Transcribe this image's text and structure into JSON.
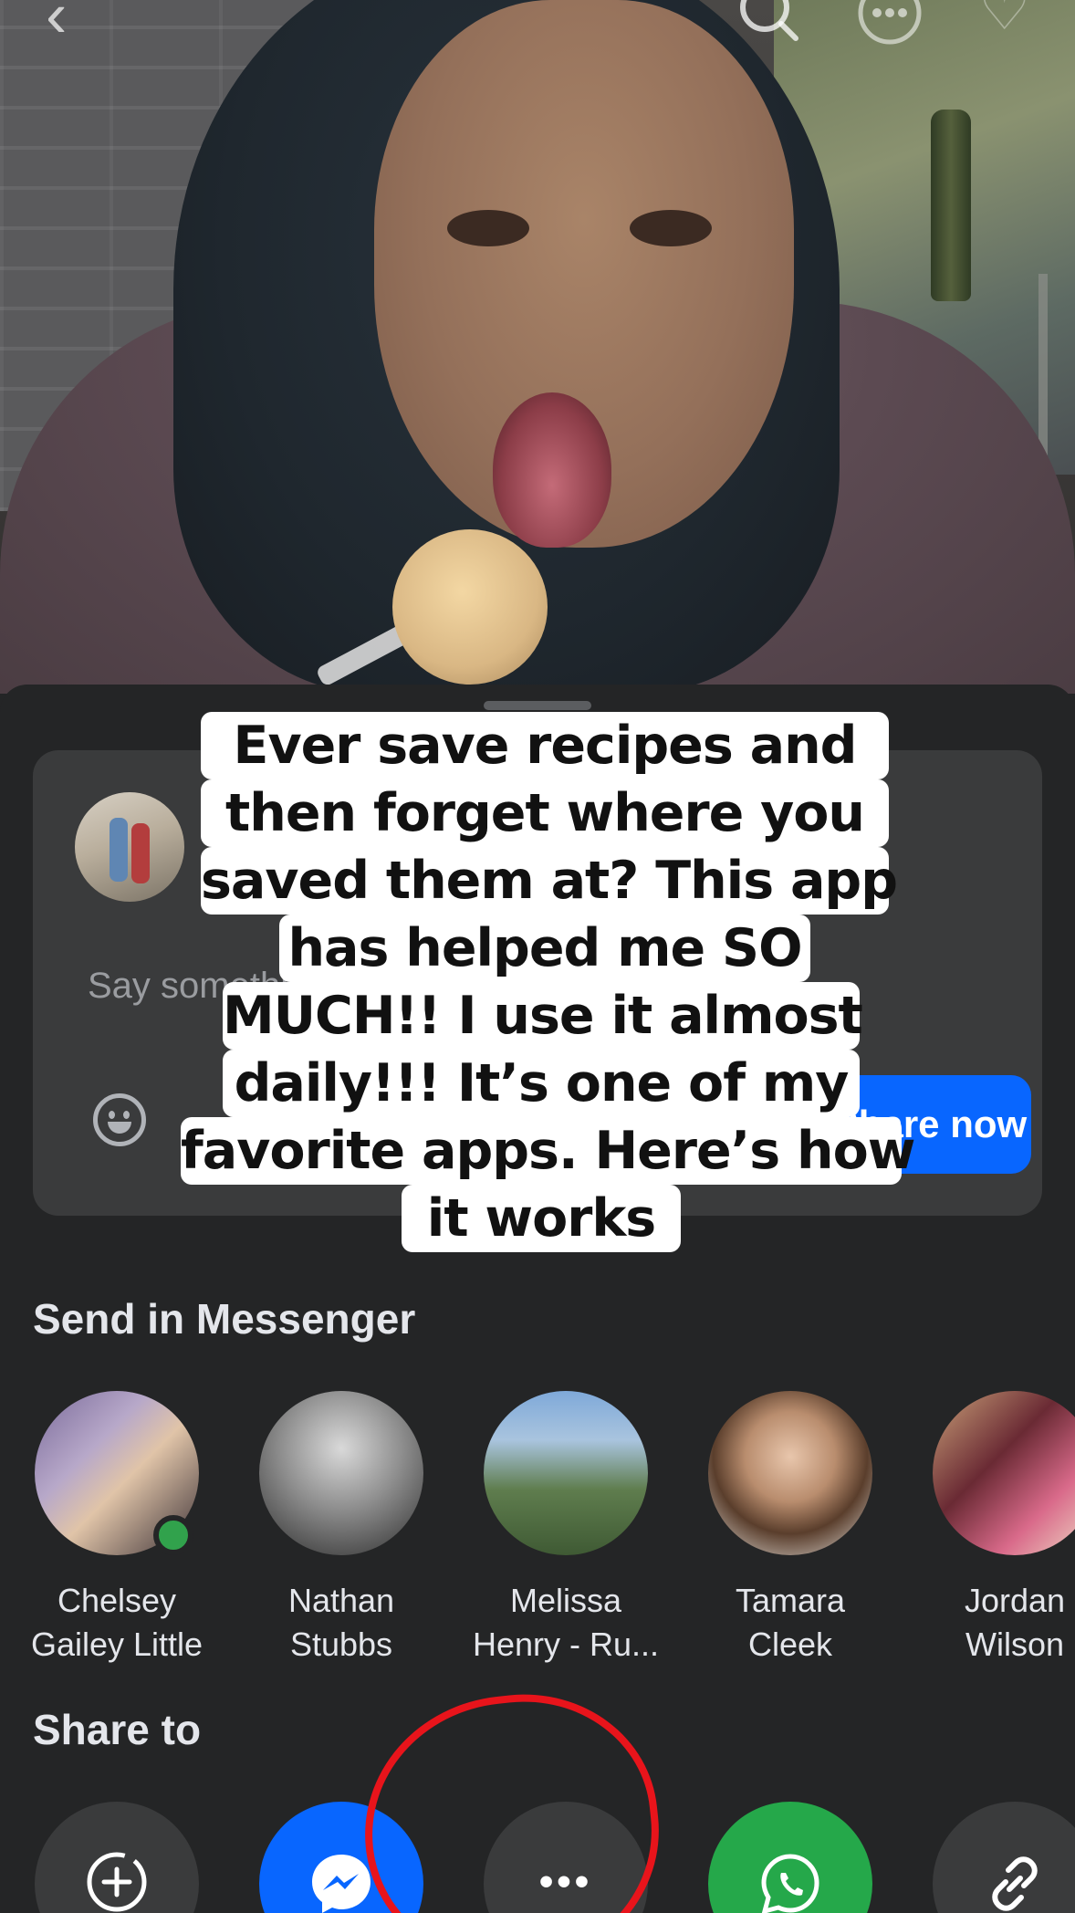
{
  "caption": {
    "lines": [
      "Ever save recipes and",
      "then forget where you",
      "saved them at? This app",
      "has helped me SO",
      "MUCH!! I use it almost",
      "daily!!! It’s one of my",
      "favorite apps. Here’s how",
      "it works"
    ]
  },
  "top_bar": {
    "back_icon": "chevron-left-icon",
    "search_icon": "search-icon",
    "more_icon": "more-circle-icon",
    "glyphs": {
      "back": "‹",
      "search": "⚲",
      "more": "⋯",
      "heart": "♡"
    }
  },
  "compose": {
    "placeholder": "Say something about this...",
    "share_button": "Share now"
  },
  "messenger": {
    "title": "Send in Messenger",
    "contacts": [
      {
        "line1": "Chelsey",
        "line2": "Gailey Little",
        "online": true
      },
      {
        "line1": "Nathan",
        "line2": "Stubbs",
        "online": false
      },
      {
        "line1": "Melissa",
        "line2": "Henry - Ru...",
        "online": false
      },
      {
        "line1": "Tamara",
        "line2": "Cleek",
        "online": false
      },
      {
        "line1": "Jordan",
        "line2": "Wilson",
        "online": false
      }
    ]
  },
  "share_to": {
    "title": "Share to",
    "buttons": [
      {
        "name": "add-to-story",
        "icon": "plus-circle-icon",
        "glyph": "⊕",
        "color": "#3a3b3c"
      },
      {
        "name": "messenger",
        "icon": "messenger-icon",
        "glyph": "ϟ",
        "color": "#0866ff"
      },
      {
        "name": "more",
        "icon": "more-horizontal-icon",
        "glyph": "•••",
        "color": "#3a3b3c"
      },
      {
        "name": "whatsapp",
        "icon": "whatsapp-icon",
        "glyph": "✆",
        "color": "#25a84a"
      },
      {
        "name": "copy-link",
        "icon": "link-icon",
        "glyph": "🔗",
        "color": "#3a3b3c"
      }
    ]
  },
  "annotation": {
    "color": "#e8141b",
    "target": "more"
  }
}
